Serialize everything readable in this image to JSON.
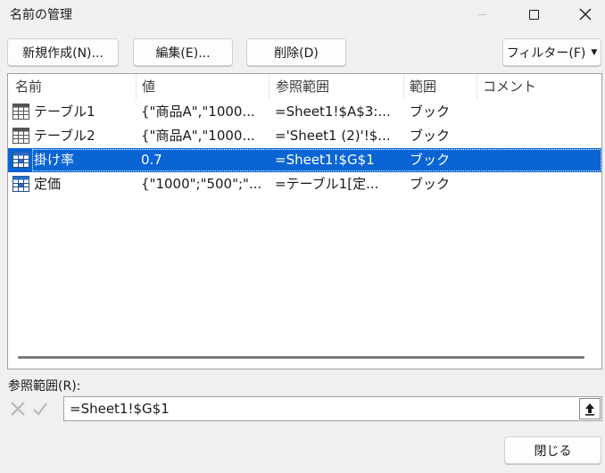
{
  "window": {
    "title": "名前の管理"
  },
  "toolbar": {
    "new_label": "新規作成(N)...",
    "edit_label": "編集(E)...",
    "delete_label": "削除(D)",
    "filter_label": "フィルター(F)"
  },
  "list": {
    "columns": [
      "名前",
      "値",
      "参照範囲",
      "範囲",
      "コメント"
    ],
    "rows": [
      {
        "name": "テーブル1",
        "value": "{\"商品A\",\"1000...",
        "refers_to": "=Sheet1!$A$3:...",
        "scope": "ブック",
        "icon": "table-icon",
        "selected": false
      },
      {
        "name": "テーブル2",
        "value": "{\"商品A\",\"1000...",
        "refers_to": "='Sheet1 (2)'!$...",
        "scope": "ブック",
        "icon": "table-icon",
        "selected": false
      },
      {
        "name": "掛け率",
        "value": "0.7",
        "refers_to": "=Sheet1!$G$1",
        "scope": "ブック",
        "icon": "named-range-icon",
        "selected": true
      },
      {
        "name": "定価",
        "value": "{\"1000\";\"500\";\"...",
        "refers_to": "=テーブル1[定...",
        "scope": "ブック",
        "icon": "named-range-icon",
        "selected": false
      }
    ]
  },
  "refers_to": {
    "label": "参照範囲(R):",
    "value": "=Sheet1!$G$1"
  },
  "footer": {
    "close_label": "閉じる"
  },
  "colors": {
    "selection": "#0a64d4",
    "background": "#f0f0f0"
  }
}
